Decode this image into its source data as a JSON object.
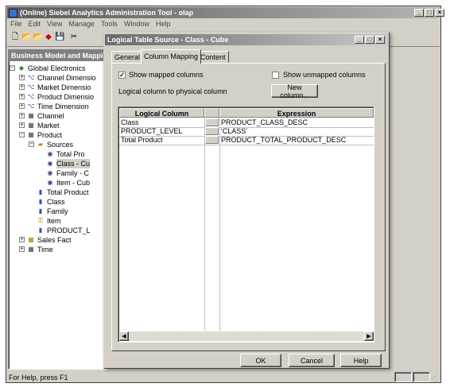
{
  "main_window": {
    "title": "(Online) Siebel Analytics Administration Tool - olap",
    "menu": [
      "File",
      "Edit",
      "View",
      "Manage",
      "Tools",
      "Window",
      "Help"
    ]
  },
  "left_pane": {
    "header": "Business Model and Mappi",
    "tree": [
      {
        "label": "Global Electronics",
        "expander": "−",
        "icon": "business-model-icon"
      },
      {
        "label": "Channel Dimensio",
        "expander": "+",
        "icon": "dimension-icon"
      },
      {
        "label": "Market Dimensio",
        "expander": "+",
        "icon": "dimension-icon"
      },
      {
        "label": "Product Dimensio",
        "expander": "+",
        "icon": "dimension-icon"
      },
      {
        "label": "Time Dimension",
        "expander": "+",
        "icon": "dimension-icon"
      },
      {
        "label": "Channel",
        "expander": "+",
        "icon": "table-icon"
      },
      {
        "label": "Market",
        "expander": "+",
        "icon": "table-icon"
      },
      {
        "label": "Product",
        "expander": "−",
        "icon": "table-icon"
      },
      {
        "label": "Sources",
        "expander": "−",
        "icon": "sources-icon"
      },
      {
        "label": "Total Pro",
        "expander": "",
        "icon": "source-icon"
      },
      {
        "label": "Class - Cu",
        "expander": "",
        "icon": "source-icon"
      },
      {
        "label": "Family - C",
        "expander": "",
        "icon": "source-icon"
      },
      {
        "label": "Item - Cub",
        "expander": "",
        "icon": "source-icon"
      },
      {
        "label": "Total Product",
        "expander": "",
        "icon": "column-icon"
      },
      {
        "label": "Class",
        "expander": "",
        "icon": "column-icon"
      },
      {
        "label": "Family",
        "expander": "",
        "icon": "column-icon"
      },
      {
        "label": "Item",
        "expander": "",
        "icon": "key-column-icon"
      },
      {
        "label": "PRODUCT_L",
        "expander": "",
        "icon": "column-icon"
      },
      {
        "label": "Sales Fact",
        "expander": "+",
        "icon": "fact-table-icon"
      },
      {
        "label": "Time",
        "expander": "+",
        "icon": "table-icon"
      }
    ]
  },
  "status_bar": {
    "text": "For Help, press F1"
  },
  "dialog": {
    "title": "Logical Table Source - Class - Cube",
    "tabs": [
      "General",
      "Column Mapping",
      "Content"
    ],
    "active_tab": "Column Mapping",
    "show_mapped": {
      "label": "Show mapped columns",
      "checked": true
    },
    "show_unmapped": {
      "label": "Show unmapped columns",
      "checked": false
    },
    "mapping_caption": "Logical column to physical column",
    "new_column_button": "New column...",
    "grid": {
      "columns": [
        "Logical Column",
        "Expression"
      ],
      "rows": [
        {
          "logical": "Class",
          "expression": "PRODUCT_CLASS_DESC"
        },
        {
          "logical": "PRODUCT_LEVEL",
          "expression": "'CLASS'"
        },
        {
          "logical": "Total Product",
          "expression": "PRODUCT_TOTAL_PRODUCT_DESC"
        }
      ]
    },
    "buttons": {
      "ok": "OK",
      "cancel": "Cancel",
      "help": "Help"
    }
  }
}
